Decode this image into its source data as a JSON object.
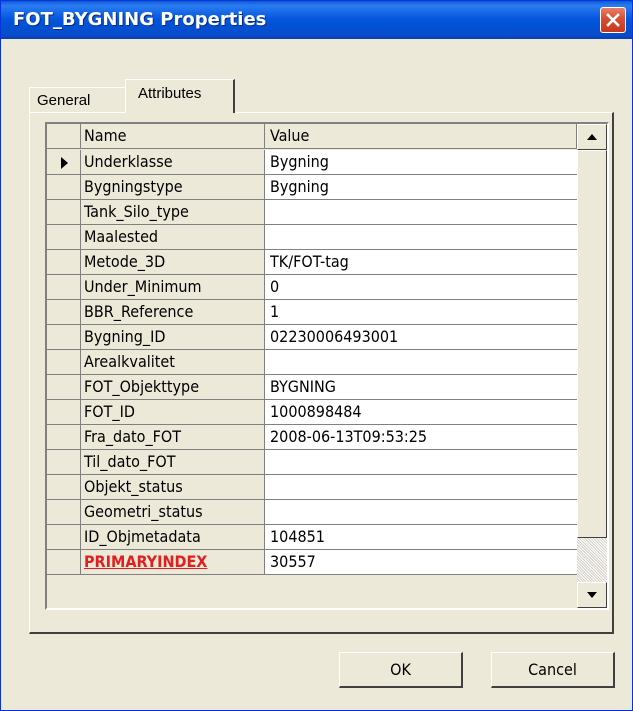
{
  "window": {
    "title": "FOT_BYGNING Properties"
  },
  "tabs": [
    {
      "label": "General",
      "selected": false
    },
    {
      "label": "Attributes",
      "selected": true
    }
  ],
  "grid": {
    "columns": [
      "Name",
      "Value"
    ],
    "current_row": 0,
    "rows": [
      {
        "name": "Underklasse",
        "value": "Bygning"
      },
      {
        "name": "Bygningstype",
        "value": "Bygning"
      },
      {
        "name": "Tank_Silo_type",
        "value": ""
      },
      {
        "name": "Maalested",
        "value": ""
      },
      {
        "name": "Metode_3D",
        "value": "TK/FOT-tag"
      },
      {
        "name": "Under_Minimum",
        "value": "0"
      },
      {
        "name": "BBR_Reference",
        "value": "1"
      },
      {
        "name": "Bygning_ID",
        "value": "02230006493001"
      },
      {
        "name": "Arealkvalitet",
        "value": ""
      },
      {
        "name": "FOT_Objekttype",
        "value": "BYGNING"
      },
      {
        "name": "FOT_ID",
        "value": "1000898484"
      },
      {
        "name": "Fra_dato_FOT",
        "value": "2008-06-13T09:53:25"
      },
      {
        "name": "Til_dato_FOT",
        "value": ""
      },
      {
        "name": "Objekt_status",
        "value": ""
      },
      {
        "name": "Geometri_status",
        "value": ""
      },
      {
        "name": "ID_Objmetadata",
        "value": "104851"
      },
      {
        "name": "PRIMARYINDEX",
        "value": "30557",
        "highlight": true
      }
    ]
  },
  "buttons": {
    "ok": "OK",
    "cancel": "Cancel"
  },
  "colors": {
    "title_bar": "#0052d6",
    "primary_index": "#e02020",
    "dialog_bg": "#ece9d8"
  }
}
